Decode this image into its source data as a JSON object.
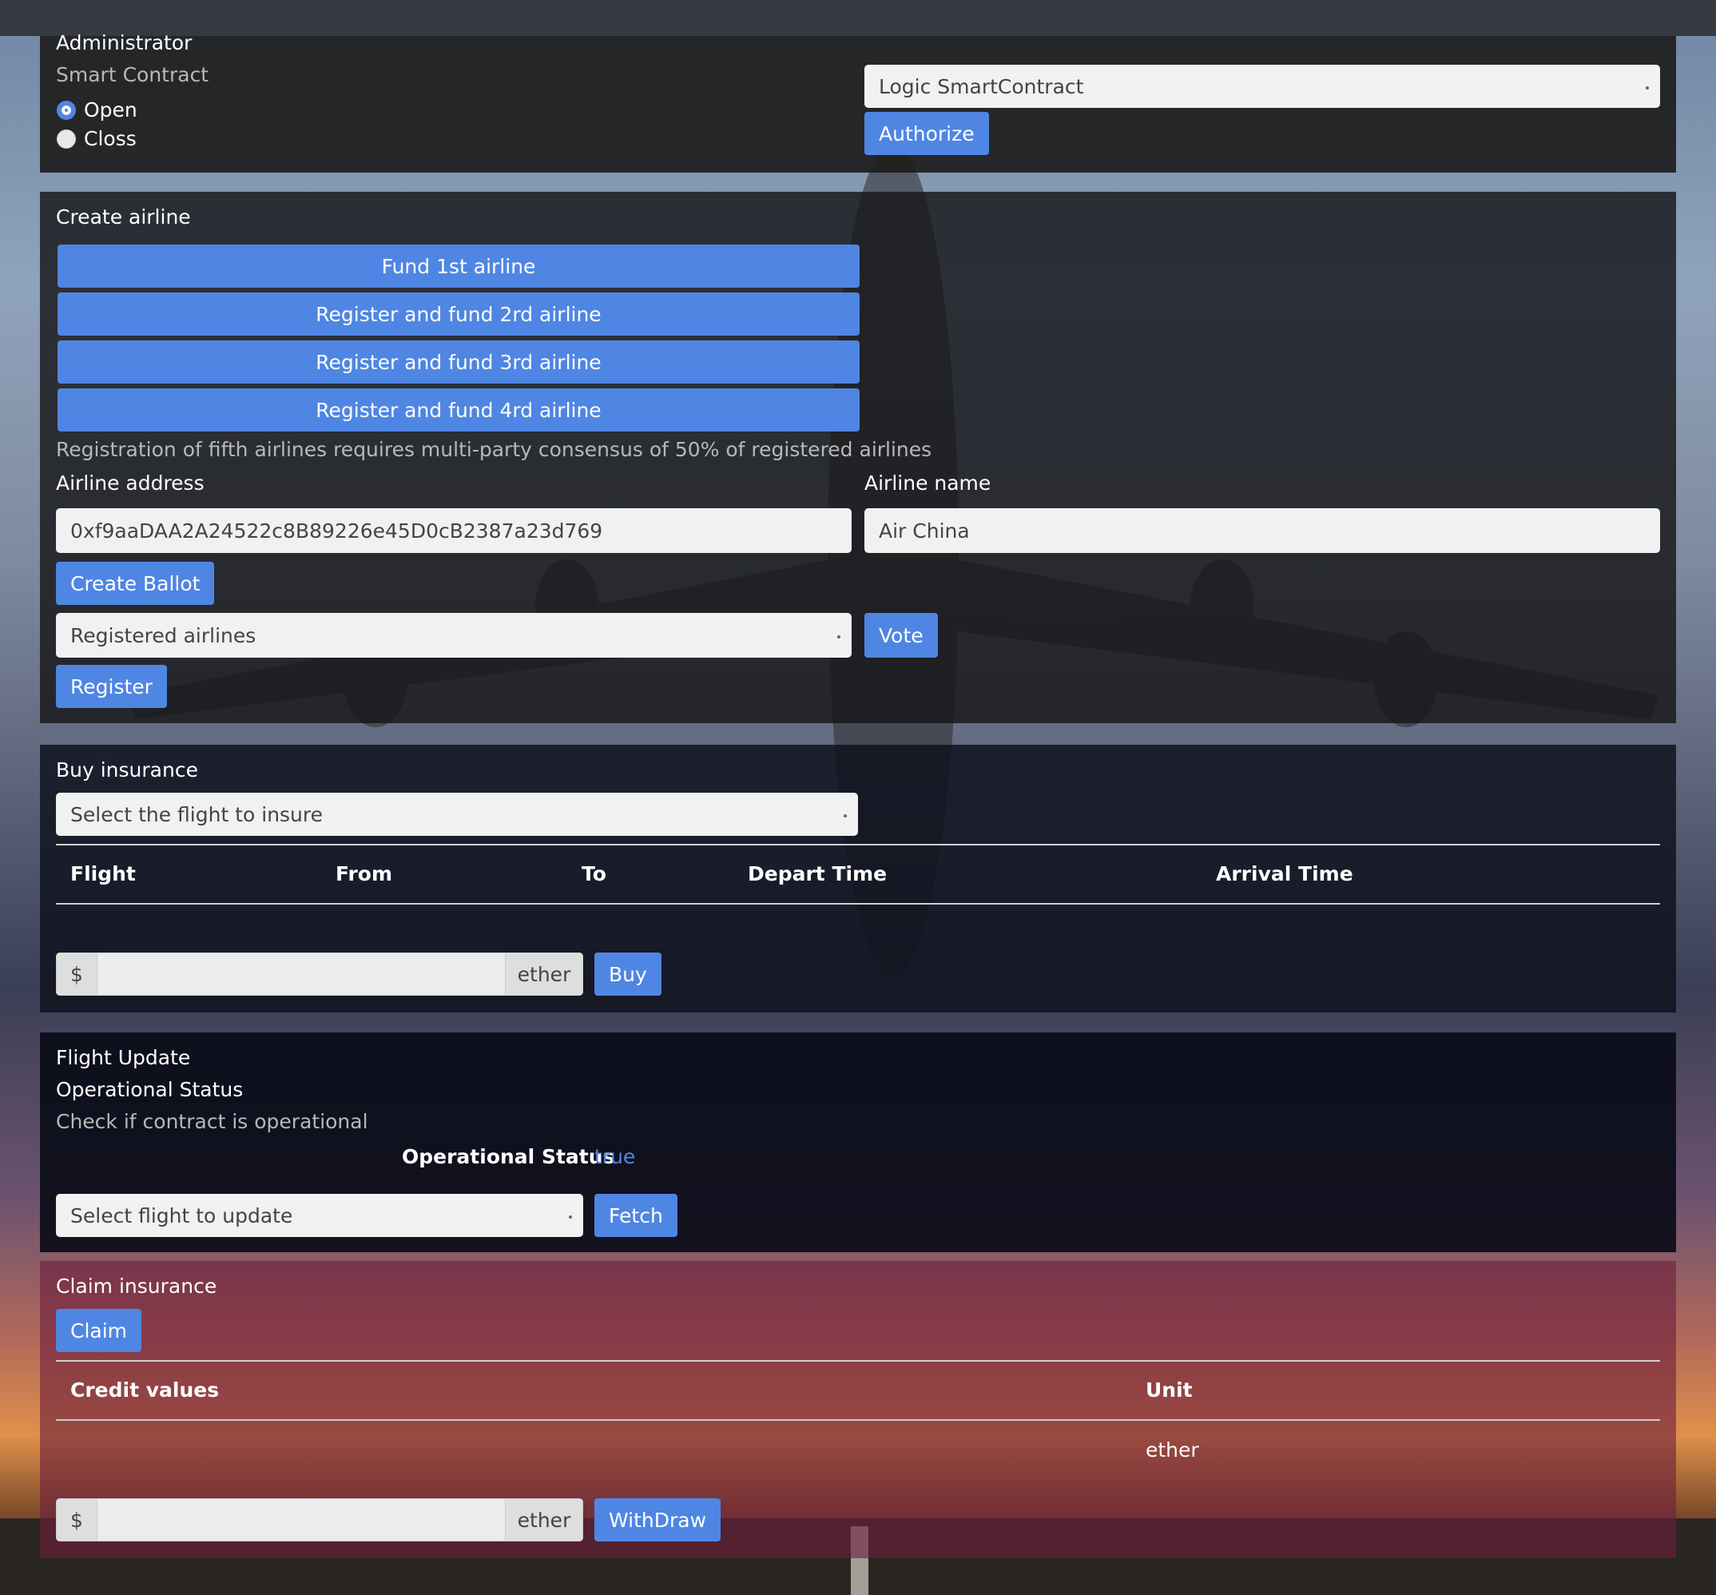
{
  "admin": {
    "title": "Administrator",
    "subtitle": "Smart Contract",
    "radio_open": "Open",
    "radio_close": "Closs",
    "select_value": "Logic SmartContract",
    "authorize_label": "Authorize"
  },
  "create_airline": {
    "title": "Create airline",
    "buttons": [
      "Fund 1st airline",
      "Register and fund 2rd airline",
      "Register and fund 3rd airline",
      "Register and fund 4rd airline"
    ],
    "note": "Registration of fifth airlines requires multi-party consensus of 50% of registered airlines",
    "address_label": "Airline address",
    "address_value": "0xf9aaDAA2A24522c8B89226e45D0cB2387a23d769",
    "name_label": "Airline name",
    "name_value": "Air China",
    "create_ballot_label": "Create Ballot",
    "registered_select": "Registered airlines",
    "vote_label": "Vote",
    "register_label": "Register"
  },
  "buy_insurance": {
    "title": "Buy insurance",
    "select_placeholder": "Select the flight to insure",
    "columns": [
      "Flight",
      "From",
      "To",
      "Depart Time",
      "Arrival Time"
    ],
    "currency_prefix": "$",
    "currency_suffix": "ether",
    "buy_label": "Buy"
  },
  "flight_update": {
    "title": "Flight Update",
    "subtitle": "Operational Status",
    "note": "Check if contract is operational",
    "status_label": "Operational Status",
    "status_value": "true",
    "select_placeholder": "Select flight to update",
    "fetch_label": "Fetch"
  },
  "claim": {
    "title": "Claim insurance",
    "claim_label": "Claim",
    "columns": [
      "Credit values",
      "Unit"
    ],
    "row_unit": "ether",
    "currency_prefix": "$",
    "currency_suffix": "ether",
    "withdraw_label": "WithDraw"
  },
  "colors": {
    "primary": "#4f86e3",
    "topbar": "#343a40",
    "status_true": "#4f86e3"
  }
}
